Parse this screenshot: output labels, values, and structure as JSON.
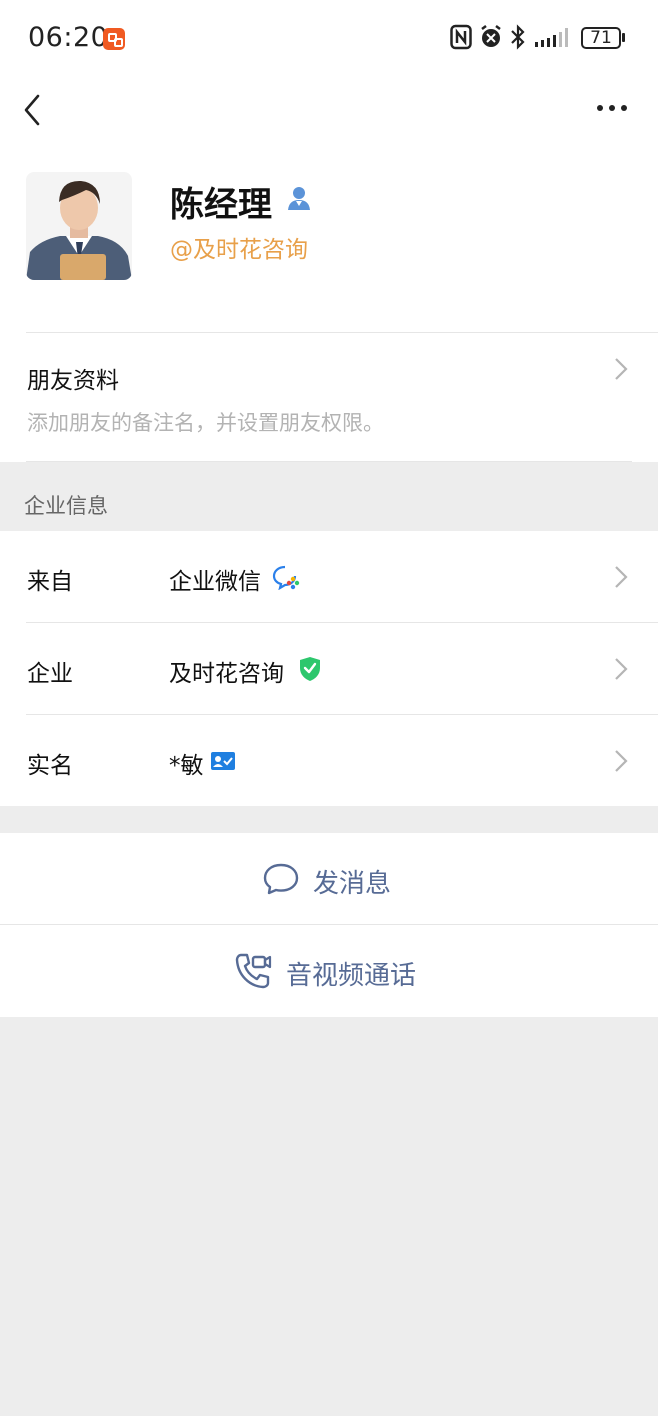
{
  "status_bar": {
    "time": "06:20",
    "battery": "71",
    "icons": [
      "app-notification-icon",
      "nfc-icon",
      "alarm-icon",
      "bluetooth-icon",
      "signal-icon",
      "battery-icon"
    ]
  },
  "nav": {
    "back_icon": "chevron-left-icon",
    "more_icon": "more-dots-icon"
  },
  "profile": {
    "name": "陈经理",
    "org": "@及时花咨询",
    "badge_icon": "person-badge-icon"
  },
  "friend_section": {
    "title": "朋友资料",
    "subtitle": "添加朋友的备注名，并设置朋友权限。"
  },
  "enterprise": {
    "section_label": "企业信息",
    "rows": [
      {
        "label": "来自",
        "value": "企业微信",
        "icon": "wecom-logo-icon"
      },
      {
        "label": "企业",
        "value": "及时花咨询",
        "icon": "verified-shield-icon"
      },
      {
        "label": "实名",
        "value": "*敏",
        "icon": "id-card-icon"
      }
    ]
  },
  "actions": {
    "message": "发消息",
    "call": "音视频通话"
  },
  "colors": {
    "accent_link": "#576b95",
    "org_orange": "#e8a04a",
    "verified_green": "#2dc76d",
    "id_blue": "#1f7fe0",
    "background": "#ededed"
  }
}
